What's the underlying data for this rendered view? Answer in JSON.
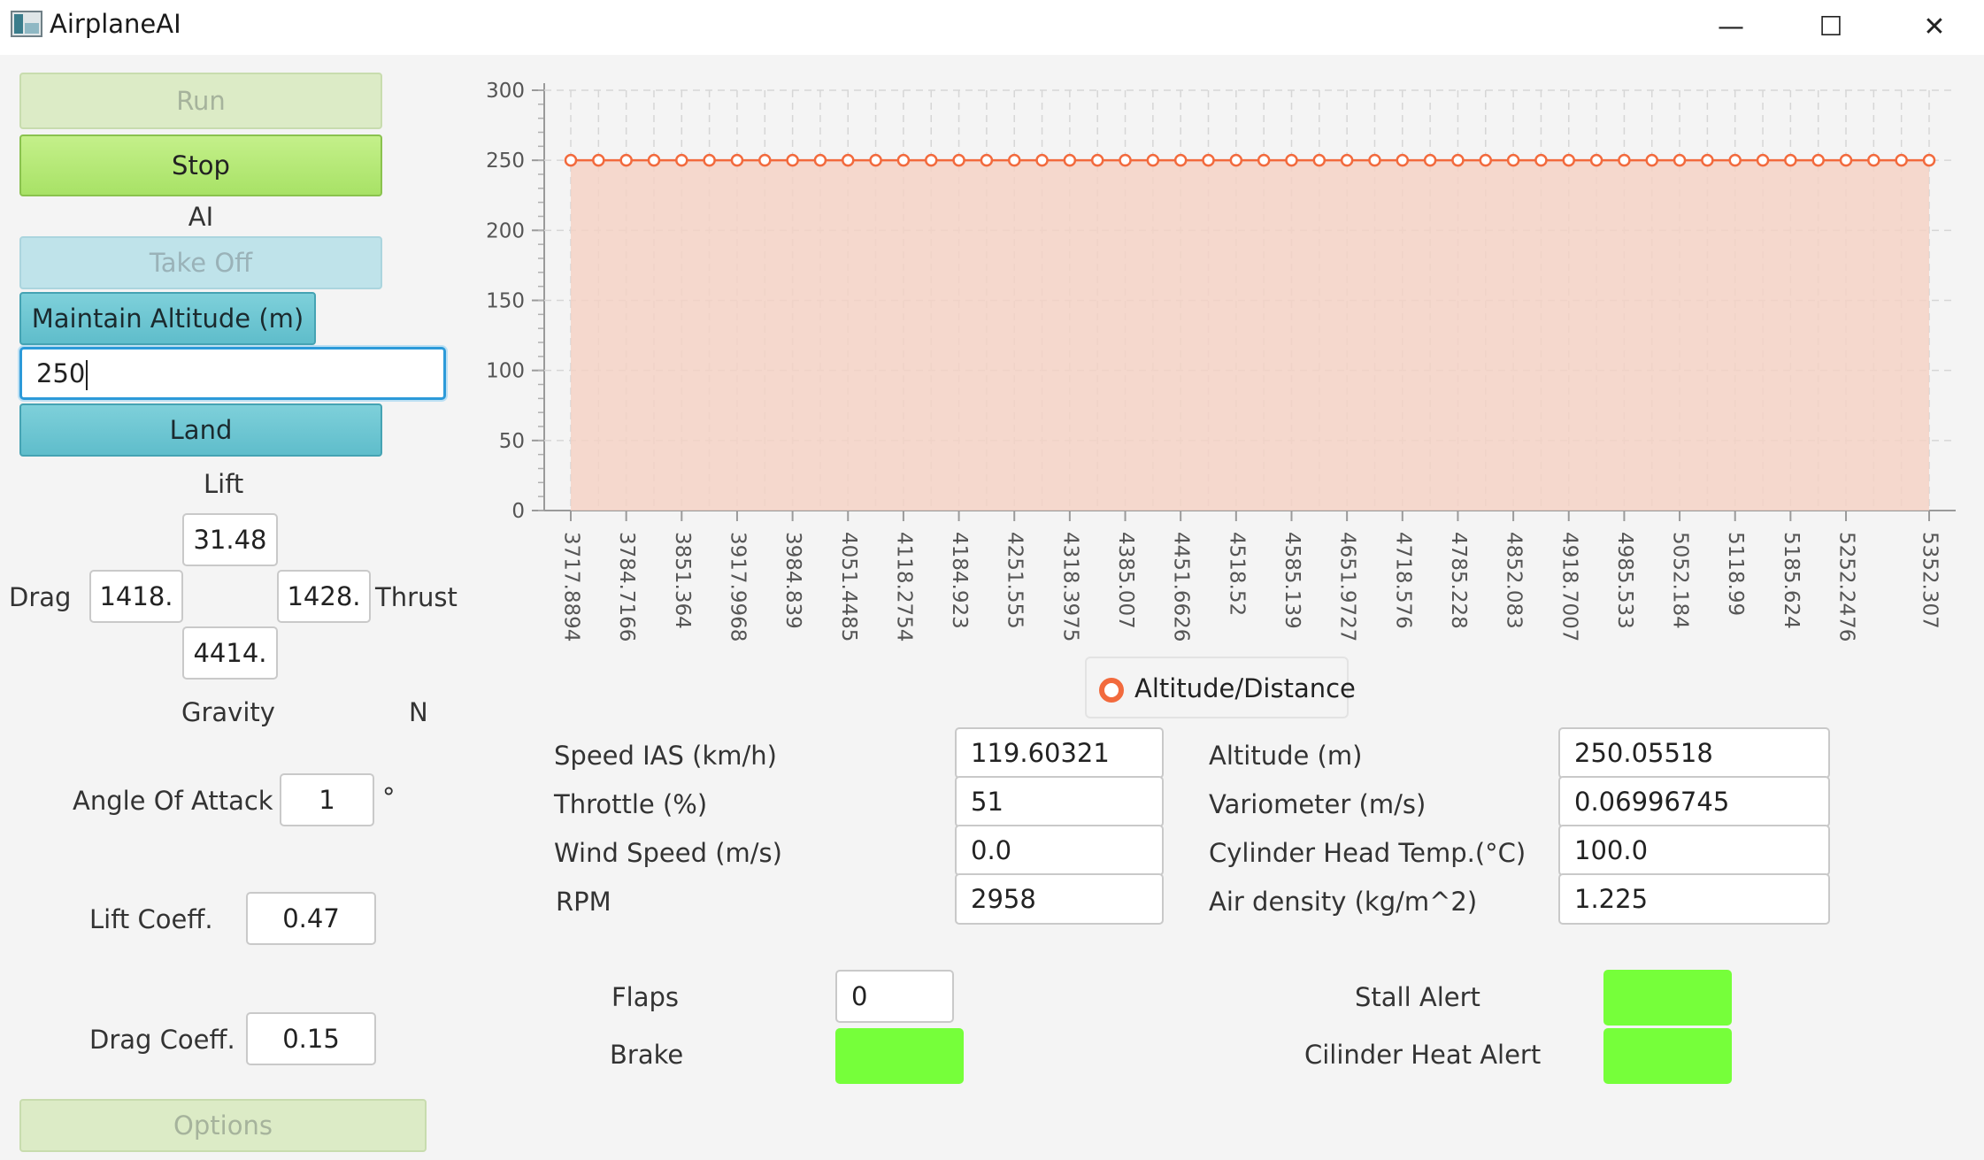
{
  "window": {
    "title": "AirplaneAI",
    "minimize": "—",
    "maximize": "☐",
    "close": "✕"
  },
  "left": {
    "run": "Run",
    "stop": "Stop",
    "ai_label": "AI",
    "take_off": "Take Off",
    "maintain_altitude": "Maintain Altitude (m)",
    "altitude_input": "250",
    "land": "Land",
    "forces": {
      "lift_label": "Lift",
      "lift_value": "31.48",
      "drag_label": "Drag",
      "drag_value": "1418.",
      "thrust_label": "Thrust",
      "thrust_value": "1428.",
      "gravity_label": "Gravity",
      "gravity_value": "4414.",
      "unit": "N"
    },
    "angle_of_attack_label": "Angle Of Attack",
    "angle_of_attack_value": "1",
    "degree_symbol": "°",
    "lift_coeff_label": "Lift Coeff.",
    "lift_coeff_value": "0.47",
    "drag_coeff_label": "Drag Coeff.",
    "drag_coeff_value": "0.15",
    "options": "Options"
  },
  "chart_data": {
    "type": "area",
    "title": "",
    "xlabel": "",
    "ylabel": "",
    "ylim": [
      0,
      300
    ],
    "yticks": [
      0,
      50,
      100,
      150,
      200,
      250,
      300
    ],
    "x_tick_labels": [
      "3717.8894",
      "3784.7166",
      "3851.364",
      "3917.9968",
      "3984.839",
      "4051.4485",
      "4118.2754",
      "4184.923",
      "4251.555",
      "4318.3975",
      "4385.007",
      "4451.6626",
      "4518.52",
      "4585.139",
      "4651.9727",
      "4718.576",
      "4785.228",
      "4852.083",
      "4918.7007",
      "4985.533",
      "5052.184",
      "5118.99",
      "5185.624",
      "5252.2476",
      "5352.307"
    ],
    "point_count": 50,
    "series": [
      {
        "name": "Altitude/Distance",
        "value": 250
      }
    ],
    "grid": true,
    "legend_position": "bottom",
    "colors": {
      "line": "#f26a3d",
      "fill": "#f5d2c6"
    }
  },
  "stats": {
    "speed_label": "Speed IAS (km/h)",
    "speed_value": "119.60321",
    "throttle_label": "Throttle (%)",
    "throttle_value": "51",
    "wind_label": "Wind Speed (m/s)",
    "wind_value": "0.0",
    "rpm_label": "RPM",
    "rpm_value": "2958",
    "altitude_label": "Altitude (m)",
    "altitude_value": "250.05518",
    "variometer_label": "Variometer (m/s)",
    "variometer_value": "0.06996745",
    "cht_label": "Cylinder Head Temp.(°C)",
    "cht_value": "100.0",
    "air_density_label": "Air density (kg/m^2)",
    "air_density_value": "1.225"
  },
  "bottom": {
    "flaps_label": "Flaps",
    "flaps_value": "0",
    "brake_label": "Brake",
    "stall_alert_label": "Stall Alert",
    "heat_alert_label": "Cilinder Heat Alert",
    "alert_color": "#76ff3a"
  }
}
